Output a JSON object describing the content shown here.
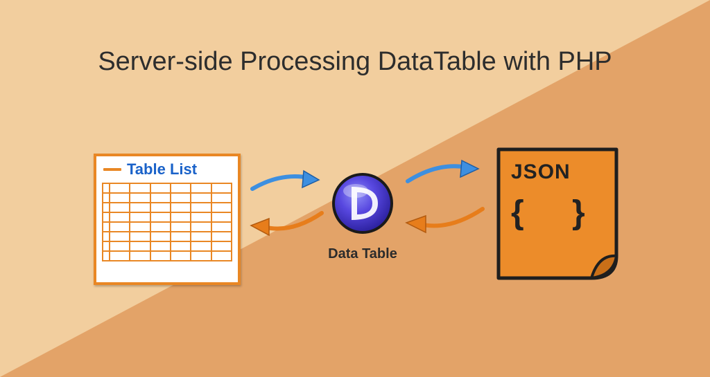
{
  "title": "Server-side Processing DataTable with PHP",
  "table": {
    "header": "Table List"
  },
  "datatable": {
    "label": "Data Table"
  },
  "json": {
    "label": "JSON",
    "braces": "{ }"
  },
  "colors": {
    "bg_light": "#f2ce9e",
    "bg_dark": "#e3a368",
    "orange": "#e98724",
    "blue_arrow": "#3d8fe0",
    "orange_arrow": "#e77d1b",
    "dt_blue": "#4a3fd6"
  }
}
